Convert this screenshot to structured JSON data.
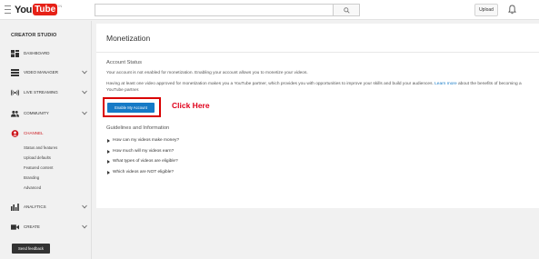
{
  "header": {
    "logo_you": "You",
    "logo_tube": "Tube",
    "logo_tm": "IN",
    "search_placeholder": "",
    "upload_label": "Upload",
    "icons": {
      "menu": "hamburger-icon",
      "search": "search-icon",
      "notifications": "bell-icon"
    }
  },
  "sidebar": {
    "title": "CREATOR STUDIO",
    "items": [
      {
        "label": "DASHBOARD",
        "icon": "dashboard-icon",
        "chevron": false,
        "active": false
      },
      {
        "label": "VIDEO MANAGER",
        "icon": "video-manager-icon",
        "chevron": true,
        "active": false
      },
      {
        "label": "LIVE STREAMING",
        "icon": "live-streaming-icon",
        "chevron": true,
        "active": false
      },
      {
        "label": "COMMUNITY",
        "icon": "community-icon",
        "chevron": true,
        "active": false
      },
      {
        "label": "CHANNEL",
        "icon": "channel-icon",
        "chevron": false,
        "active": true
      },
      {
        "label": "ANALYTICS",
        "icon": "analytics-icon",
        "chevron": true,
        "active": false
      },
      {
        "label": "CREATE",
        "icon": "create-icon",
        "chevron": true,
        "active": false
      }
    ],
    "channel_subitems": [
      "Status and features",
      "Upload defaults",
      "Featured content",
      "Branding",
      "Advanced"
    ],
    "feedback_label": "Send feedback",
    "active_color": "#cc181e"
  },
  "main": {
    "title": "Monetization",
    "account_status_heading": "Account Status",
    "status_text": "Your account is not enabled for monetization. Enabling your account allows you to monetize your videos.",
    "partner_text": "Having at least one video approved for monetization makes you a YouTube partner, which provides you with opportunities to improve your skills and build your audiences.",
    "learn_more": "Learn more",
    "partner_text_tail": "about the benefits of becoming a YouTube partner.",
    "enable_button": "Enable My Account",
    "annotation": "Click Here",
    "guidelines_heading": "Guidelines and Information",
    "faq": [
      "How can my videos make money?",
      "How much will my videos earn?",
      "What types of videos are eligible?",
      "Which videos are NOT eligible?"
    ],
    "accent_color": "#167ac6",
    "annotation_color": "#e0001b"
  }
}
